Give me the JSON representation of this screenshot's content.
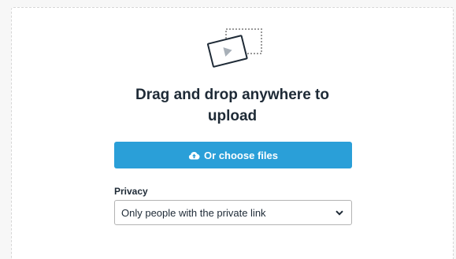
{
  "dropzone": {
    "heading_line1": "Drag and drop anywhere to",
    "heading_line2": "upload",
    "illustration_icon": "video-file-icon",
    "choose_button": {
      "label": "Or choose files",
      "icon": "cloud-upload-icon"
    }
  },
  "privacy": {
    "label": "Privacy",
    "selected": "Only people with the private link",
    "dropdown_icon": "chevron-down-icon"
  },
  "colors": {
    "accent": "#2a9fd8",
    "text": "#1e2a36",
    "border": "#b3b3b3"
  }
}
